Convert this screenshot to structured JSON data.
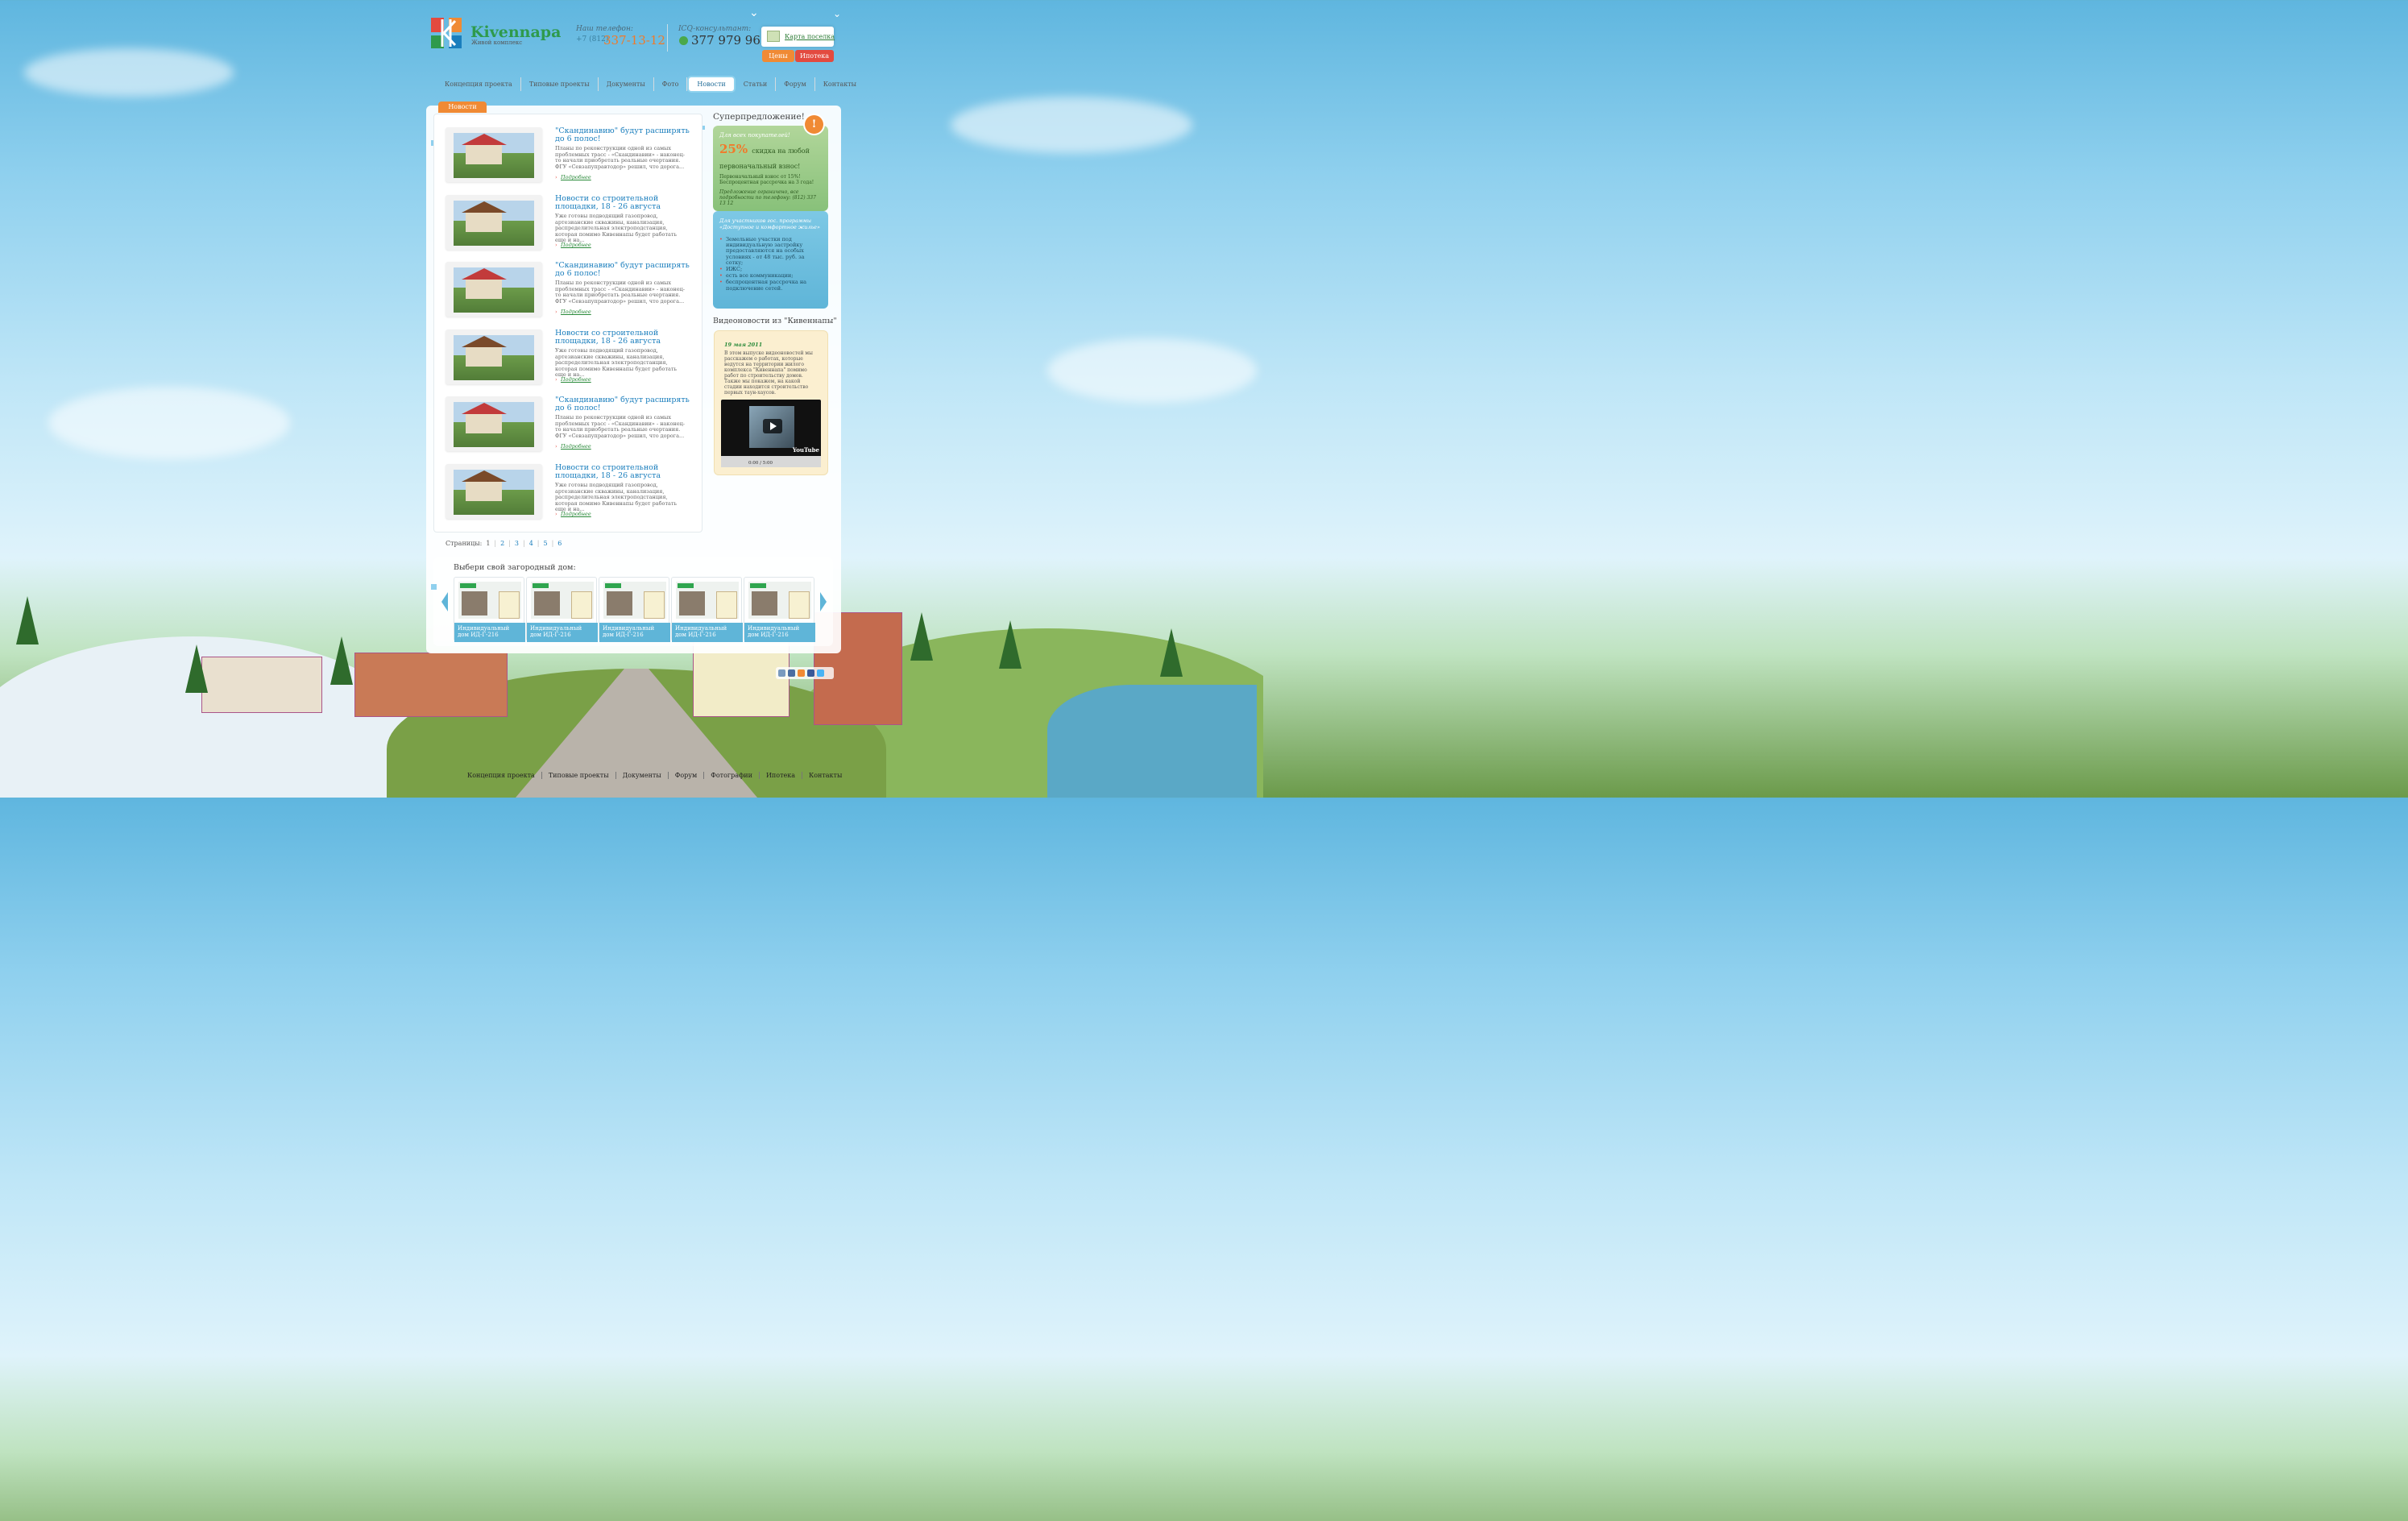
{
  "header": {
    "logo_title": "Kivennapa",
    "logo_subtitle": "Живой комплекс",
    "phone_label": "Наш телефон:",
    "phone_code": "+7 (812)",
    "phone_number": "337-13-12",
    "icq_label": "ICQ-консультант:",
    "icq_number": "377 979 962",
    "map_link": "Карта поселка",
    "prices_button": "Цены",
    "mortgage_button": "Ипотека"
  },
  "nav": {
    "items": [
      "Концепция проекта",
      "Типовые проекты",
      "Документы",
      "Фото",
      "Новости",
      "Статьи",
      "Форум",
      "Контакты"
    ],
    "active": "Новости"
  },
  "main": {
    "tab_label": "Новости",
    "news": [
      {
        "title": "\"Скандинавию\" будут расширять до 6 полос!",
        "text": "Планы по реконструкции одной из самых проблемных трасс - «Скандинавии» - наконец-то начали приобретать реальные очертания. ФГУ «Севзапуправтодор» решил, что дорога...",
        "more": "Подробнее",
        "roof": "red"
      },
      {
        "title": "Новости со строительной площадки, 18 - 26 августа",
        "text": "Уже готовы подводящий газопровод, артезианские скважины, канализация, распределительная электроподстанция, которая помимо Кивеннапы будет работать еще и на...",
        "more": "Подробнее",
        "roof": "brown"
      },
      {
        "title": "\"Скандинавию\" будут расширять до 6 полос!",
        "text": "Планы по реконструкции одной из самых проблемных трасс - «Скандинавии» - наконец-то начали приобретать реальные очертания. ФГУ «Севзапуправтодор» решил, что дорога...",
        "more": "Подробнее",
        "roof": "red"
      },
      {
        "title": "Новости со строительной площадки, 18 - 26 августа",
        "text": "Уже готовы подводящий газопровод, артезианские скважины, канализация, распределительная электроподстанция, которая помимо Кивеннапы будет работать еще и на...",
        "more": "Подробнее",
        "roof": "brown"
      },
      {
        "title": "\"Скандинавию\" будут расширять до 6 полос!",
        "text": "Планы по реконструкции одной из самых проблемных трасс - «Скандинавии» - наконец-то начали приобретать реальные очертания. ФГУ «Севзапуправтодор» решил, что дорога...",
        "more": "Подробнее",
        "roof": "red"
      },
      {
        "title": "Новости со строительной площадки, 18 - 26 августа",
        "text": "Уже готовы подводящий газопровод, артезианские скважины, канализация, распределительная электроподстанция, которая помимо Кивеннапы будет работать еще и на...",
        "more": "Подробнее",
        "roof": "brown"
      }
    ],
    "pager_label": "Страницы:",
    "pages": [
      "1",
      "2",
      "3",
      "4",
      "5",
      "6"
    ]
  },
  "sidebar": {
    "super_title": "Суперпредложение!",
    "super_badge": "!",
    "green": {
      "label": "Для всех покупателей!",
      "percent": "25%",
      "discount": "скидка на любой первоначальный взнос!",
      "line1": "Первоначальный взнос от 15%!",
      "line2": "Беспроцентная рассрочка на 3 года!",
      "note": "Предложение ограничено, все подробности по телефону: (812) 337 13 12"
    },
    "blue": {
      "label": "Для участников гос. программы «Доступное и комфортное жилье»",
      "items": [
        "Земельные участки под индивидуальную застройку предоставляются на особых условиях - от 48 тыс. руб. за сотку;",
        "ИЖС;",
        "есть все коммуникации;",
        "беспроцентная рассрочка на подключение сетей."
      ]
    },
    "video_title": "Видеоновости из \"Кивеннапы\"",
    "video_date": "19 мая 2011",
    "video_text": "В этом выпуске видеоновостей мы расскажем о работах, которые ведутся на территории жилого комплекса \"Кивеннапа\" помимо работ по строительству домов. Также мы покажем, на какой стадии находится строительство первых таун-хаусов.",
    "video_time": "0:00 / 5:00",
    "video_brand": "YouTube"
  },
  "catalog": {
    "title": "Выбери свой загородный дом:",
    "houses": [
      "Индивидуальный дом ИД-Г-216",
      "Индивидуальный дом ИД-Г-216",
      "Индивидуальный дом ИД-Г-216",
      "Индивидуальный дом ИД-Г-216",
      "Индивидуальный дом ИД-Г-216"
    ]
  },
  "footer": {
    "items": [
      "Концепция проекта",
      "Типовые проекты",
      "Документы",
      "Форум",
      "Фотографии",
      "Ипотека",
      "Контакты"
    ]
  },
  "colors": {
    "accent": "#f08a34",
    "brand_green": "#2e9a4c",
    "link_blue": "#1a7ebd",
    "sky": "#8fd0ee"
  }
}
